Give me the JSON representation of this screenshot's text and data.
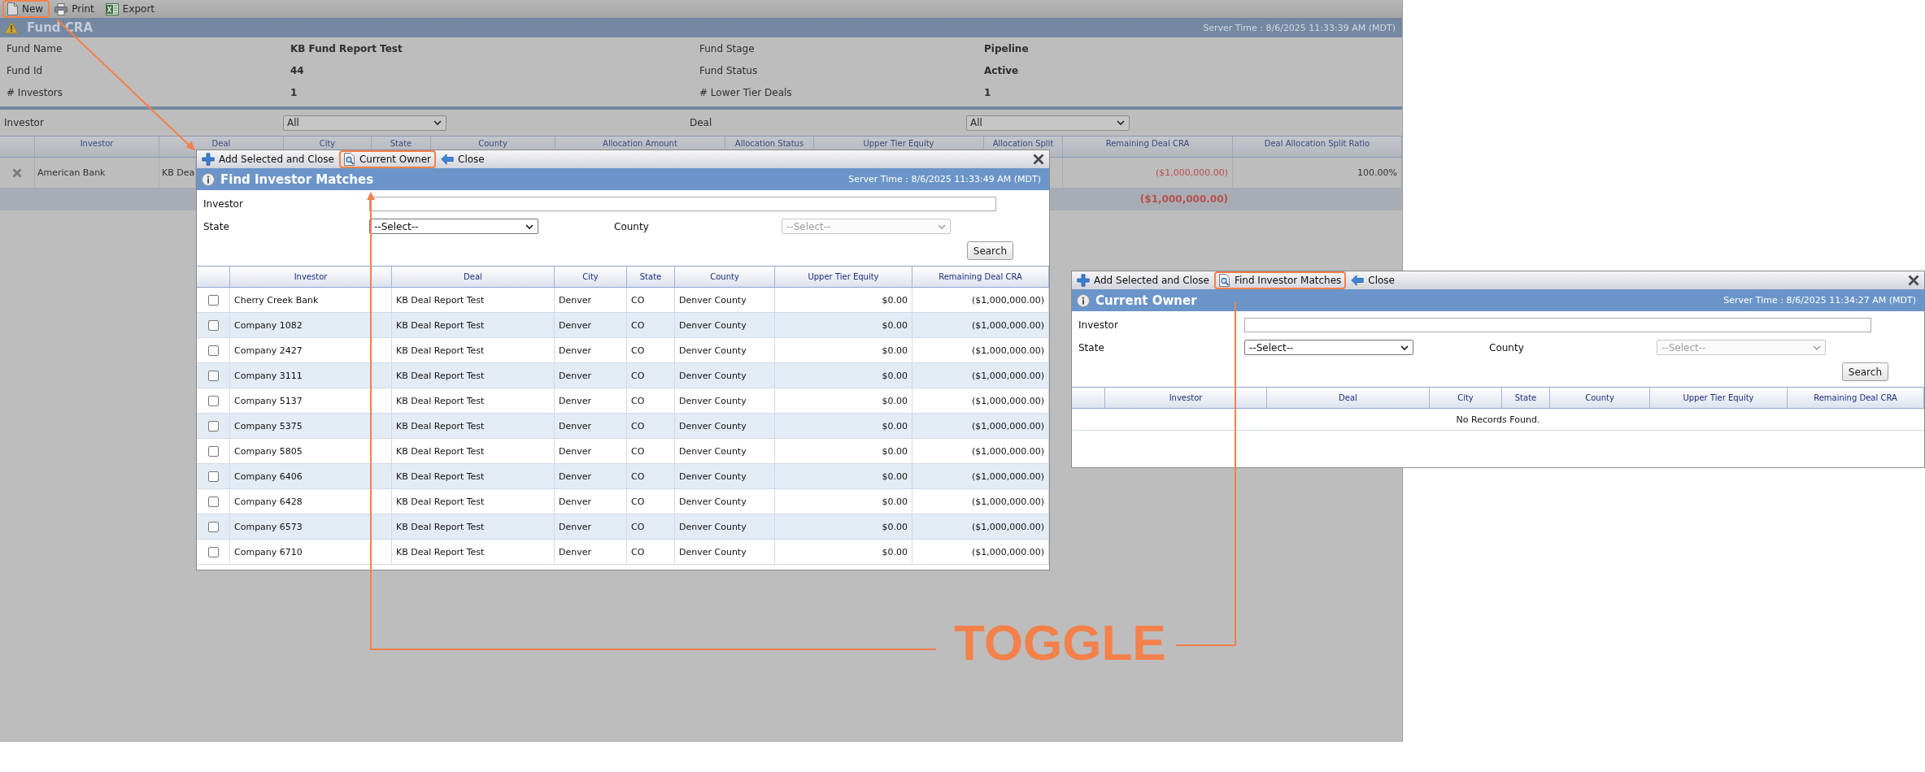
{
  "toolbar": {
    "buttons": [
      {
        "kind": "new",
        "label": "New",
        "highlighted": true
      },
      {
        "kind": "print",
        "label": "Print",
        "highlighted": false
      },
      {
        "kind": "export",
        "label": "Export",
        "highlighted": false
      }
    ]
  },
  "page_header": {
    "title": "Fund CRA",
    "server_time": "Server Time : 8/6/2025 11:33:39 AM (MDT)"
  },
  "fund_details": [
    {
      "label": "Fund Name",
      "value": "KB Fund Report Test"
    },
    {
      "label": "Fund Stage",
      "value": "Pipeline"
    },
    {
      "label": "Fund Id",
      "value": "44"
    },
    {
      "label": "Fund Status",
      "value": "Active"
    },
    {
      "label": "# Investors",
      "value": "1"
    },
    {
      "label": "# Lower Tier Deals",
      "value": "1"
    }
  ],
  "filters": [
    {
      "label": "Investor",
      "value": "All"
    },
    {
      "label": "Deal",
      "value": "All"
    }
  ],
  "allocations_table": {
    "columns": [
      "Investor",
      "Deal",
      "City",
      "State",
      "County",
      "Allocation Amount",
      "Allocation Status",
      "Upper Tier Equity",
      "Allocation Split",
      "Remaining Deal CRA",
      "Deal Allocation Split Ratio"
    ],
    "rows": [
      {
        "investor": "American Bank",
        "deal": "KB Dea",
        "remaining_deal_cra": "($1,000,000.00)",
        "deal_allocation_split_ratio": "100.00%"
      }
    ],
    "total": {
      "remaining_deal_cra": "($1,000,000.00)"
    }
  },
  "dialogs": [
    {
      "toolbar": [
        {
          "kind": "add",
          "label": "Add Selected and Close",
          "highlighted": false
        },
        {
          "kind": "toggle",
          "label": "Current Owner",
          "highlighted": true
        },
        {
          "kind": "close",
          "label": "Close",
          "highlighted": false
        }
      ],
      "title": "Find Investor Matches",
      "server_time": "Server Time : 8/6/2025 11:33:49 AM (MDT)",
      "fields": [
        {
          "kind": "text",
          "label": "Investor"
        },
        {
          "kind": "select",
          "label": "State",
          "value": "--Select--",
          "disabled": false
        },
        {
          "kind": "select",
          "label": "County",
          "value": "--Select--",
          "disabled": true
        }
      ],
      "search_button": "Search",
      "columns": [
        "Investor",
        "Deal",
        "City",
        "State",
        "County",
        "Upper Tier Equity",
        "Remaining Deal CRA"
      ],
      "rows": [
        {
          "checked": false,
          "cells": [
            "Cherry Creek Bank",
            "KB Deal Report Test",
            "Denver",
            "CO",
            "Denver County",
            "$0.00",
            "($1,000,000.00)"
          ]
        },
        {
          "checked": false,
          "cells": [
            "Company 1082",
            "KB Deal Report Test",
            "Denver",
            "CO",
            "Denver County",
            "$0.00",
            "($1,000,000.00)"
          ]
        },
        {
          "checked": false,
          "cells": [
            "Company 2427",
            "KB Deal Report Test",
            "Denver",
            "CO",
            "Denver County",
            "$0.00",
            "($1,000,000.00)"
          ]
        },
        {
          "checked": false,
          "cells": [
            "Company 3111",
            "KB Deal Report Test",
            "Denver",
            "CO",
            "Denver County",
            "$0.00",
            "($1,000,000.00)"
          ]
        },
        {
          "checked": false,
          "cells": [
            "Company 5137",
            "KB Deal Report Test",
            "Denver",
            "CO",
            "Denver County",
            "$0.00",
            "($1,000,000.00)"
          ]
        },
        {
          "checked": false,
          "cells": [
            "Company 5375",
            "KB Deal Report Test",
            "Denver",
            "CO",
            "Denver County",
            "$0.00",
            "($1,000,000.00)"
          ]
        },
        {
          "checked": false,
          "cells": [
            "Company 5805",
            "KB Deal Report Test",
            "Denver",
            "CO",
            "Denver County",
            "$0.00",
            "($1,000,000.00)"
          ]
        },
        {
          "checked": false,
          "cells": [
            "Company 6406",
            "KB Deal Report Test",
            "Denver",
            "CO",
            "Denver County",
            "$0.00",
            "($1,000,000.00)"
          ]
        },
        {
          "checked": false,
          "cells": [
            "Company 6428",
            "KB Deal Report Test",
            "Denver",
            "CO",
            "Denver County",
            "$0.00",
            "($1,000,000.00)"
          ]
        },
        {
          "checked": false,
          "cells": [
            "Company 6573",
            "KB Deal Report Test",
            "Denver",
            "CO",
            "Denver County",
            "$0.00",
            "($1,000,000.00)"
          ]
        },
        {
          "checked": false,
          "cells": [
            "Company 6710",
            "KB Deal Report Test",
            "Denver",
            "CO",
            "Denver County",
            "$0.00",
            "($1,000,000.00)"
          ]
        }
      ]
    },
    {
      "toolbar": [
        {
          "kind": "add",
          "label": "Add Selected and Close",
          "highlighted": false
        },
        {
          "kind": "toggle",
          "label": "Find Investor Matches",
          "highlighted": true
        },
        {
          "kind": "close",
          "label": "Close",
          "highlighted": false
        }
      ],
      "title": "Current Owner",
      "server_time": "Server Time : 8/6/2025 11:34:27 AM (MDT)",
      "fields": [
        {
          "kind": "text",
          "label": "Investor"
        },
        {
          "kind": "select",
          "label": "State",
          "value": "--Select--",
          "disabled": false
        },
        {
          "kind": "select",
          "label": "County",
          "value": "--Select--",
          "disabled": true
        }
      ],
      "search_button": "Search",
      "columns": [
        "Investor",
        "Deal",
        "City",
        "State",
        "County",
        "Upper Tier Equity",
        "Remaining Deal CRA"
      ],
      "empty_message": "No Records Found."
    }
  ],
  "annotation": {
    "label": "TOGGLE"
  }
}
